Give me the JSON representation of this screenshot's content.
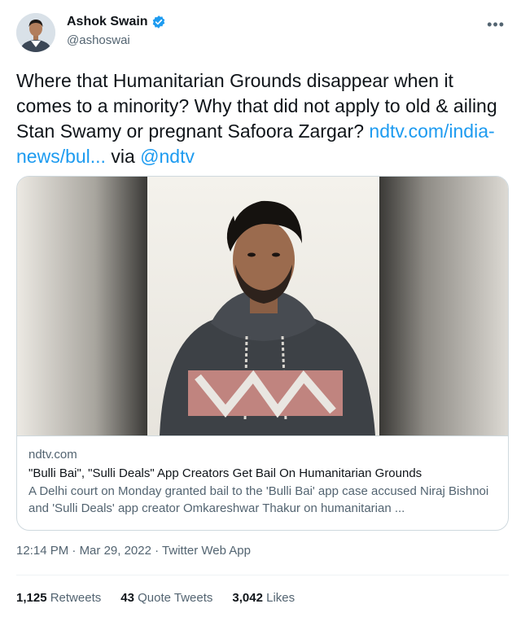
{
  "author": {
    "display_name": "Ashok Swain",
    "handle": "@ashoswai"
  },
  "tweet": {
    "text": "Where that Humanitarian Grounds disappear when it comes to a minority? Why that did not apply to old & ailing Stan Swamy or pregnant Safoora Zargar?",
    "link_text": "ndtv.com/india-news/bul...",
    "via_text": "via",
    "mention": "@ndtv"
  },
  "card": {
    "domain": "ndtv.com",
    "title": "\"Bulli Bai\", \"Sulli Deals\" App Creators Get Bail On Humanitarian Grounds",
    "description": "A Delhi court on Monday granted bail to the 'Bulli Bai' app case accused Niraj Bishnoi and 'Sulli Deals' app creator Omkareshwar Thakur on humanitarian ..."
  },
  "meta": {
    "time": "12:14 PM",
    "date": "Mar 29, 2022",
    "source": "Twitter Web App",
    "separator": "·"
  },
  "stats": {
    "retweets_count": "1,125",
    "retweets_label": "Retweets",
    "quotes_count": "43",
    "quotes_label": "Quote Tweets",
    "likes_count": "3,042",
    "likes_label": "Likes"
  },
  "colors": {
    "link": "#1d9bf0",
    "verified": "#1d9bf0",
    "secondary_text": "#536471"
  },
  "icons": {
    "verified": "verified-badge-icon",
    "more": "more-options-icon"
  }
}
